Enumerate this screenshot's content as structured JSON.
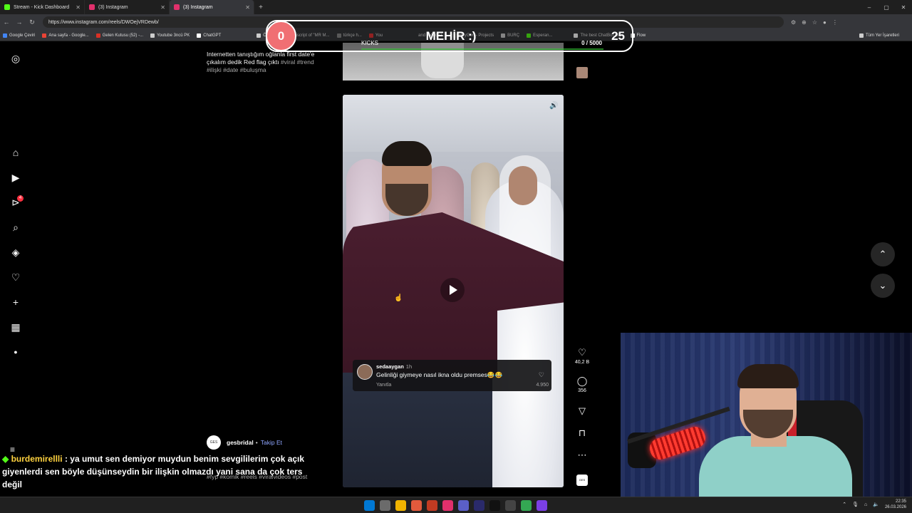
{
  "browser": {
    "tabs": [
      {
        "title": "Stream - Kick Dashboard",
        "color": "#53fc18"
      },
      {
        "title": "(3) Instagram",
        "color": "#e1306c"
      },
      {
        "title": "(3) Instagram",
        "color": "#e1306c"
      }
    ],
    "url": "https://www.instagram.com/reels/DWOejVRDewb/",
    "bookmarks": [
      "Google Çeviri",
      "Ana sayfa - Google...",
      "Gelen Kutusu (52) -...",
      "Youtube 3ncü PK",
      "ChatGPT",
      "Örnek",
      "Transcript of \"MR M...",
      "türkçe h...",
      "You",
      "and reduce i...",
      "HeyGen - Projects",
      "BURÇ",
      "Esperan...",
      "The best ChatBot an...",
      "Flow"
    ],
    "bookmarks_right": "Tüm Yer İşaretleri"
  },
  "instagram": {
    "sidebar_icons": [
      "instagram-logo-icon",
      "home-icon",
      "reels-icon",
      "messages-icon",
      "search-icon",
      "explore-icon",
      "notifications-icon",
      "create-icon",
      "dashboard-icon",
      "profile-icon",
      "menu-icon"
    ],
    "messages_badge": "4",
    "prev_caption": "Internetten tanıştığım oğlanla first date'e çıkalım dedik Red flag çıktı",
    "prev_tags": "#viral #trend #ilişki #date #buluşma",
    "comment": {
      "user": "sedaaygan",
      "time": "1h",
      "text": "Gelinliği giymeye nasıl ikna oldu premses😂😂",
      "reply": "Yanıtla",
      "likes": "4.950"
    },
    "actions": {
      "likes": "40,2 B",
      "comments": "356"
    },
    "author": {
      "avatar_text": "GES",
      "username": "gesbridal",
      "separator": "•",
      "follow": "Takip Et"
    },
    "caption_tags": "#fyp #komik #reels #viralvideos #post",
    "audio_thumb_text": "GES"
  },
  "overlay": {
    "count": "0",
    "title": "MEHİR :)",
    "goal": "25",
    "kicks_label": "KICKS",
    "progress": "0 / 5000"
  },
  "chat": {
    "username": "burdemirellli",
    "message": ": ya umut sen demiyor muydun benim sevgililerim çok açık giyenlerdi sen böyle düşünseydin bir ilişkin olmazdı yani sana da çok ters değil"
  },
  "taskbar": {
    "time": "22:35",
    "date": "26.03.2026",
    "apps": [
      "#0078d4",
      "#6b6b6b",
      "#f0b400",
      "#e25a3c",
      "#c23b22",
      "#e1306c",
      "#5b5fc7",
      "#2a2a6a",
      "#111111",
      "#444444",
      "#34a853",
      "#7b3fe4"
    ]
  }
}
